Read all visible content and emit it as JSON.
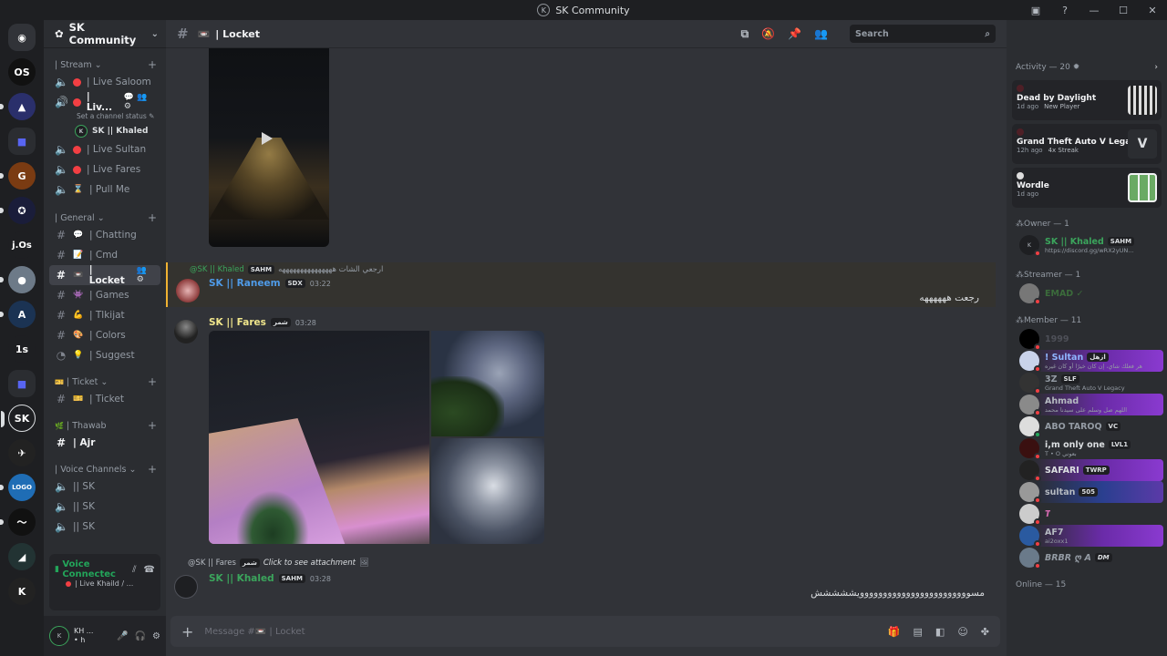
{
  "window": {
    "title": "SK Community"
  },
  "servers": [
    "OS",
    "j.Os",
    "1s"
  ],
  "server_header": {
    "name": "SK Community"
  },
  "categories": {
    "stream": "| Stream",
    "general": "| General",
    "ticket": "| Ticket",
    "thawab": "| Thawab",
    "voice": "| Voice Channels"
  },
  "channels": {
    "live_saloom": "| Live Saloom",
    "live_current": "| Liv...",
    "status_hint": "Set a channel status",
    "voice_user": "SK || Khaled",
    "live_sultan": "| Live Sultan",
    "live_fares": "| Live Fares",
    "pull_me": "| Pull Me",
    "chatting": "| Chatting",
    "cmd": "| Cmd",
    "locket": "| Locket",
    "games": "| Games",
    "tlkijat": "| Tlkijat",
    "colors": "| Colors",
    "suggest": "| Suggest",
    "ticket": "| Ticket",
    "ajr": "| Ajr",
    "sk1": "|| SK",
    "sk2": "|| SK",
    "sk3": "|| SK"
  },
  "voice_panel": {
    "status": "Voice Connectec",
    "channel": "| Live Khaild / ..."
  },
  "user_panel": {
    "name": "KH ...",
    "sub": "• h"
  },
  "header": {
    "channel": "| Locket",
    "search_placeholder": "Search"
  },
  "messages": {
    "reply1": {
      "to": "@SK || Khaled",
      "tag": "SAHM",
      "text": "ارجعي الشات هههههههههههههههه"
    },
    "m1": {
      "author": "SK || Raneem",
      "tag": "SDX",
      "time": "03:22",
      "text": "رجعت ههههههه"
    },
    "m2": {
      "author": "SK || Fares",
      "tag": "شمر",
      "time": "03:28"
    },
    "reply2": {
      "to": "@SK || Fares",
      "tag": "شمر",
      "text": "Click to see attachment"
    },
    "m3": {
      "author": "SK || Khaled",
      "tag": "SAHM",
      "time": "03:28",
      "text": "مسوووووووووووووووووووووووويششششش"
    }
  },
  "composer": {
    "placeholder": "Message #📼 | Locket"
  },
  "activity": {
    "header": "Activity — 20",
    "cards": [
      {
        "game": "Dead by Daylight",
        "ago": "1d ago",
        "note": "New Player"
      },
      {
        "game": "Grand Theft Auto V Legacy",
        "ago": "12h ago",
        "note": "4x Streak"
      },
      {
        "game": "Wordle",
        "ago": "1d ago",
        "note": ""
      }
    ]
  },
  "member_groups": {
    "owner": "Owner — 1",
    "streamer": "Streamer — 1",
    "member": "Member — 11",
    "online": "Online — 15"
  },
  "members": {
    "owner": {
      "name": "SK || Khaled",
      "tag": "SAHM",
      "sub": "https://discord.gg/wRX2yUN..."
    },
    "streamer": {
      "name": "EMAD ✓"
    },
    "list": [
      {
        "name": "1999",
        "tag": "",
        "sub": ""
      },
      {
        "name": "! Sultan",
        "tag": "ازهل",
        "sub": "هر فعلك شاي، إن كان خيرًا أو كان غيره"
      },
      {
        "name": "3Z",
        "tag": "SLF",
        "sub": "Grand Theft Auto V Legacy"
      },
      {
        "name": "Ahmad",
        "tag": "",
        "sub": "اللهم صل وسلم على سيدنا محمد"
      },
      {
        "name": "ABO TAROQ",
        "tag": "VC",
        "sub": ""
      },
      {
        "name": "i,m only one",
        "tag": "LVL1",
        "sub": "T • O بعوني"
      },
      {
        "name": "SAFARI",
        "tag": "TWRP",
        "sub": ""
      },
      {
        "name": "sultan",
        "tag": "505",
        "sub": ""
      },
      {
        "name": "T",
        "tag": "",
        "sub": ""
      },
      {
        "name": "AF7",
        "tag": "",
        "sub": "ai2oxx1"
      },
      {
        "name": "BRBR ღ A",
        "tag": "DM",
        "sub": ""
      }
    ]
  },
  "colors": {
    "accent": "#5865f2",
    "online": "#23a55a",
    "dnd": "#f23f43",
    "reply_bar": "#f0b232"
  }
}
